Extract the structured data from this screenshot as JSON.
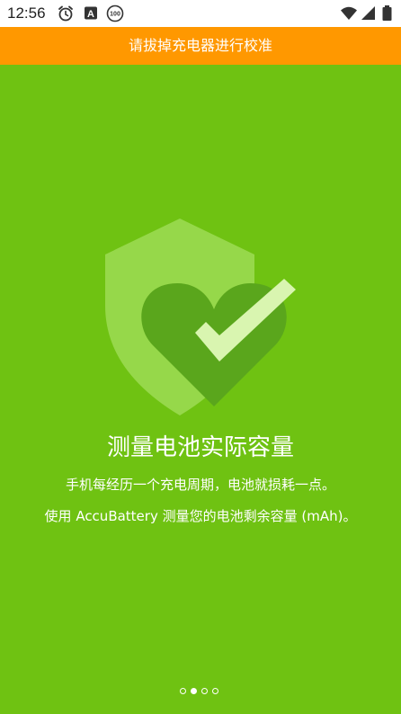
{
  "status_bar": {
    "time": "12:56",
    "icons": [
      "alarm-icon",
      "a-badge-icon",
      "battery-100-icon",
      "wifi-icon",
      "signal-icon",
      "battery-icon"
    ],
    "battery_badge_text": "100",
    "a_badge_text": "A"
  },
  "banner": {
    "text": "请拔掉充电器进行校准",
    "color": "#ff9800"
  },
  "illustration": {
    "icons": [
      "shield-icon",
      "heart-icon",
      "checkmark-icon"
    ],
    "colors": {
      "background": "#6fc212",
      "shield": "#96d84a",
      "heart": "#5aa61c",
      "check": "#d9f5b0"
    }
  },
  "content": {
    "title": "测量电池实际容量",
    "description_line_1": "手机每经历一个充电周期，电池就损耗一点。",
    "description_line_2": "使用 AccuBattery 测量您的电池剩余容量 (mAh)。"
  },
  "pager": {
    "page_count": 4,
    "active_index": 1
  }
}
